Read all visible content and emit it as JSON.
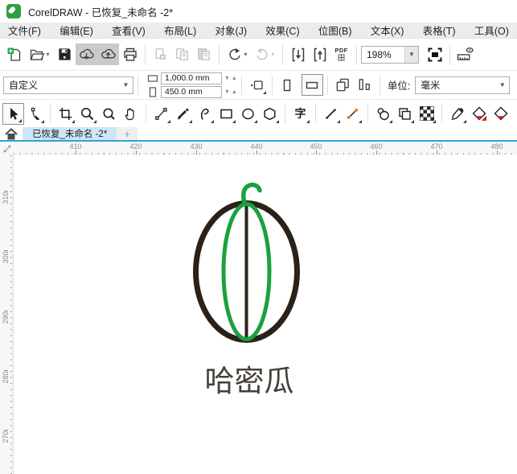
{
  "window": {
    "title": "CorelDRAW - 已恢复_未命名 -2*"
  },
  "menu": {
    "items": [
      {
        "label": "文件(F)"
      },
      {
        "label": "编辑(E)"
      },
      {
        "label": "查看(V)"
      },
      {
        "label": "布局(L)"
      },
      {
        "label": "对象(J)"
      },
      {
        "label": "效果(C)"
      },
      {
        "label": "位图(B)"
      },
      {
        "label": "文本(X)"
      },
      {
        "label": "表格(T)"
      },
      {
        "label": "工具(O)"
      }
    ]
  },
  "standard_toolbar": {
    "zoom_value": "198%",
    "pdf_label": "PDF",
    "icons": [
      "new-document",
      "open",
      "save",
      "cloud-download",
      "cloud-upload",
      "print",
      "cut",
      "copy",
      "paste",
      "undo",
      "redo",
      "import",
      "export",
      "pdf-share",
      "zoom-level",
      "full-screen-preview",
      "show-rulers"
    ]
  },
  "property_bar": {
    "page_size_preset": "自定义",
    "page_width": "1,000.0 mm",
    "page_height": "450.0 mm",
    "units_label": "单位:",
    "units_value": "毫米",
    "icons": [
      "page-width",
      "page-height",
      "nudge-offset",
      "portrait",
      "landscape",
      "all-pages",
      "current-page",
      "units-select"
    ]
  },
  "toolbox": {
    "text_tool_glyph": "字",
    "tools": [
      "pick",
      "shape",
      "crop",
      "zoom",
      "zoom-out",
      "pan",
      "freehand",
      "artistic-media",
      "curve-pen",
      "rectangle",
      "ellipse",
      "polygon",
      "text",
      "line",
      "connector",
      "shadow",
      "contour",
      "transparency",
      "eyedropper",
      "interactive-fill",
      "smart-fill"
    ]
  },
  "tab_bar": {
    "active_tab_label": "已恢复_未命名 -2*",
    "new_tab_label": "+"
  },
  "rulers": {
    "horizontal": [
      "410",
      "420",
      "430",
      "440",
      "450",
      "460",
      "470",
      "480"
    ],
    "vertical": [
      "310",
      "300",
      "290",
      "280",
      "270"
    ]
  },
  "canvas": {
    "logo_text": "哈密瓜"
  },
  "colors": {
    "accent_blue": "#30a2dd",
    "brand_green": "#2ea043",
    "melon_outline": "#2b2118",
    "melon_green": "#1aa13e",
    "logo_text_color": "#454039",
    "pressed_button_bg": "#cacaca",
    "active_tab_bg": "#cde7f8"
  }
}
